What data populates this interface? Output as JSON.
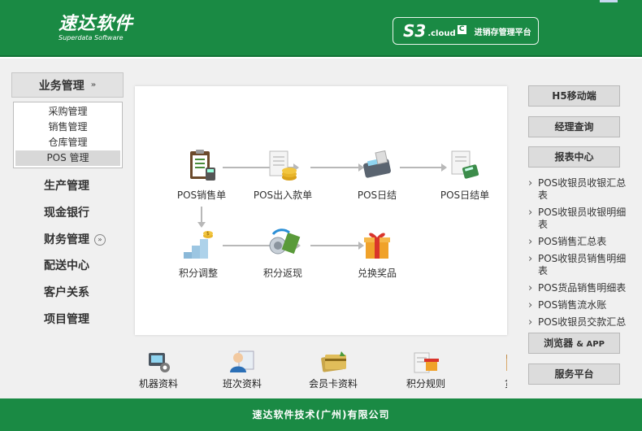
{
  "header": {
    "logo_cn": "速达软件",
    "logo_en": "Superdata Software",
    "badge_mark": "S3",
    "badge_cloud": ".cloud",
    "badge_c": "C",
    "badge_text": "进销存管理平台"
  },
  "sidebar": {
    "head_label": "业务管理",
    "submenu": [
      "采购管理",
      "销售管理",
      "仓库管理",
      "POS 管理"
    ],
    "active_submenu": "POS 管理",
    "items": [
      "生产管理",
      "现金银行",
      "财务管理",
      "配送中心",
      "客户关系",
      "项目管理"
    ]
  },
  "flow": {
    "nodes": [
      "POS销售单",
      "POS出入款单",
      "POS日结",
      "POS日结单",
      "积分调整",
      "积分返现",
      "兑换奖品"
    ]
  },
  "bottom": {
    "items": [
      "机器资料",
      "班次资料",
      "会员卡资料",
      "积分规则",
      "货品"
    ]
  },
  "right": {
    "btn_h5": "H5移动端",
    "btn_manager": "经理查询",
    "btn_report": "报表中心",
    "reports": [
      "POS收银员收银汇总表",
      "POS收银员收银明细表",
      "POS销售汇总表",
      "POS收银员销售明细表",
      "POS货品销售明细表",
      "POS销售流水账",
      "POS收银员交款汇总表"
    ],
    "btn_browser_main": "浏览器",
    "btn_browser_small": "& APP",
    "btn_service": "服务平台"
  },
  "footer": {
    "text": "速达软件技术(广州)有限公司"
  },
  "colors": {
    "brand_green": "#1a8a44",
    "panel_bg": "#f0f0f0"
  }
}
